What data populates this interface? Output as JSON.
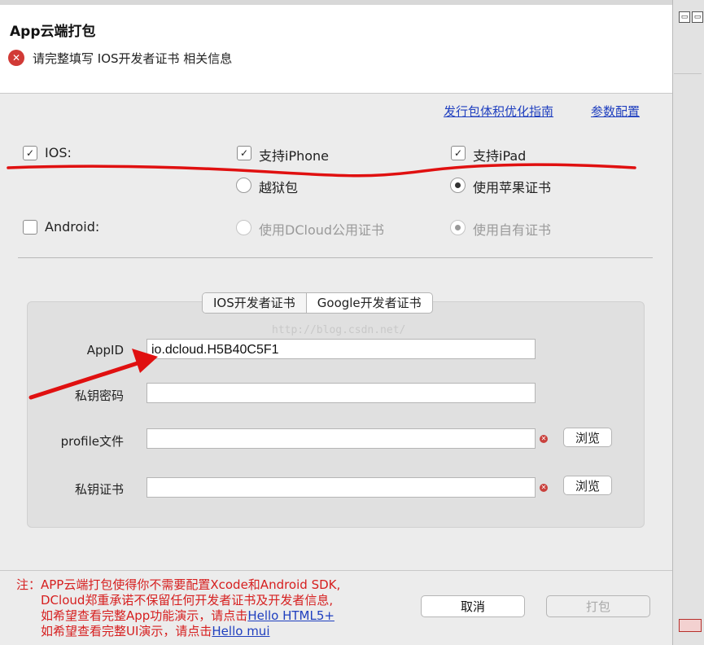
{
  "dialog": {
    "title": "App云端打包",
    "error_message": "请完整填写 IOS开发者证书 相关信息",
    "error_icon": "error-x-icon"
  },
  "links": {
    "optimize_guide": "发行包体积优化指南",
    "param_config": "参数配置"
  },
  "platforms": {
    "ios": {
      "label": "IOS:",
      "checked": true
    },
    "iphone": {
      "label": "支持iPhone",
      "checked": true
    },
    "ipad": {
      "label": "支持iPad",
      "checked": true
    },
    "jailbreak": {
      "label": "越狱包",
      "selected": false
    },
    "apple_cert": {
      "label": "使用苹果证书",
      "selected": true
    },
    "android": {
      "label": "Android:",
      "checked": false
    },
    "dcloud_cert": {
      "label": "使用DCloud公用证书",
      "selected": false
    },
    "own_cert": {
      "label": "使用自有证书",
      "selected": true
    }
  },
  "tabs": [
    {
      "label": "IOS开发者证书",
      "active": true
    },
    {
      "label": "Google开发者证书",
      "active": false
    }
  ],
  "form": {
    "appid": {
      "label": "AppID",
      "value": "io.dcloud.H5B40C5F1"
    },
    "key_password": {
      "label": "私钥密码",
      "value": ""
    },
    "profile": {
      "label": "profile文件",
      "value": "",
      "browse": "浏览"
    },
    "key_cert": {
      "label": "私钥证书",
      "value": "",
      "browse": "浏览"
    }
  },
  "watermark": "http://blog.csdn.net/",
  "footer": {
    "line1": "注：APP云端打包使得你不需要配置Xcode和Android SDK,",
    "line2": "DCloud郑重承诺不保留任何开发者证书及开发者信息,",
    "line3_prefix": "如希望查看完整App功能演示，请点击",
    "line3_link": "Hello HTML5+",
    "line4_prefix": "如希望查看完整UI演示，请点击",
    "line4_link": "Hello mui",
    "cancel": "取消",
    "build": "打包"
  },
  "colors": {
    "link": "#1f3fbf",
    "error": "#d13a36",
    "annotation": "#e01010"
  }
}
